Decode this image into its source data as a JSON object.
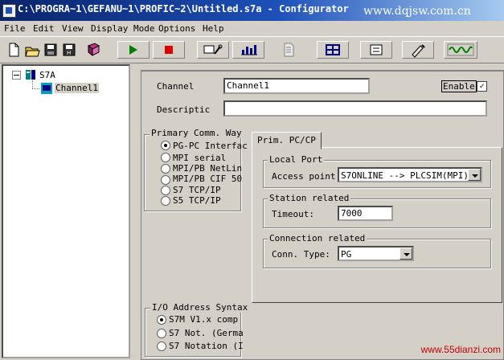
{
  "window": {
    "title": "C:\\PROGRA~1\\GEFANU~1\\PROFIC~2\\Untitled.s7a - Configurator",
    "watermark_top": "www.dqjsw.com.cn",
    "watermark_bottom": "www.55dianzi.com"
  },
  "menu": [
    "File",
    "Edit",
    "View",
    "Display Mode",
    "Options",
    "Help"
  ],
  "toolbar": {
    "icons": [
      "new-file-icon",
      "open-folder-icon",
      "save-icon",
      "save-all-icon",
      "book-icon",
      "run-icon",
      "stop-icon",
      "settings-tools-icon",
      "bar-chart-icon",
      "document-icon",
      "network-icon",
      "properties-icon",
      "edit-tool-icon",
      "waveform-icon"
    ],
    "colors": {
      "run": "#008000",
      "stop": "#e00000",
      "chart": "#000080"
    }
  },
  "tree": {
    "root": "S7A",
    "child": "Channel1"
  },
  "channel": {
    "label": "Channel",
    "value": "Channel1",
    "description_label": "Descriptic",
    "description_value": "",
    "enable_label": "Enable",
    "enable_checked": "✓"
  },
  "primary_comm": {
    "title": "Primary Comm. Way",
    "options": [
      "PG-PC Interfac",
      "MPI serial",
      "MPI/PB NetLin",
      "MPI/PB CIF 50",
      "S7 TCP/IP",
      "S5 TCP/IP"
    ],
    "selected": 0
  },
  "io_address": {
    "title": "I/O Address Syntax",
    "options": [
      "S7M V1.x comp",
      "S7 Not.  (Germa",
      "S7 Notation (I"
    ],
    "selected": 0
  },
  "tab": {
    "label": "Prim. PC/CP",
    "local_port": {
      "title": "Local Port",
      "access_label": "Access point:",
      "access_value": "S7ONLINE --> PLCSIM(MPI)"
    },
    "station": {
      "title": "Station related",
      "timeout_label": "Timeout:",
      "timeout_value": "7000"
    },
    "connection": {
      "title": "Connection related",
      "type_label": "Conn. Type:",
      "type_value": "PG"
    }
  }
}
